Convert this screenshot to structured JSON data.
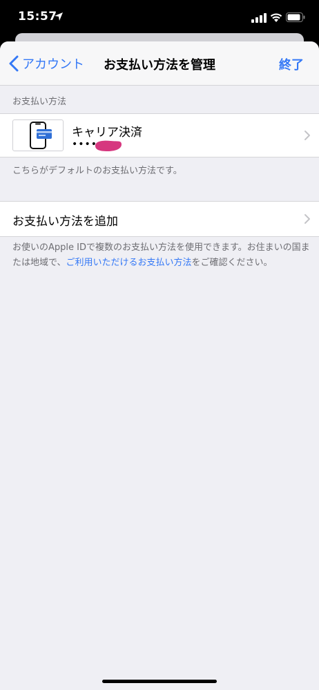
{
  "status_bar": {
    "time": "15:57",
    "icons": [
      "location-arrow-icon",
      "signal-icon",
      "wifi-icon",
      "battery-icon"
    ]
  },
  "nav": {
    "back_label": "アカウント",
    "title": "お支払い方法を管理",
    "done_label": "終了"
  },
  "section_header": "お支払い方法",
  "payment_method": {
    "title": "キャリア決済",
    "masked": "••••••",
    "icon": "phone-card-icon"
  },
  "default_note": "こちらがデフォルトのお支払い方法です。",
  "add_method_label": "お支払い方法を追加",
  "info_note": {
    "text_before": "お使いのApple IDで複数のお支払い方法を使用できます。お住まいの国または地域で、",
    "link": "ご利用いただけるお支払い方法",
    "text_after": "をご確認ください。"
  },
  "colors": {
    "accent": "#3478f6",
    "background": "#efeff4",
    "secondary_text": "#6d6d72",
    "redaction": "#d6377f"
  }
}
